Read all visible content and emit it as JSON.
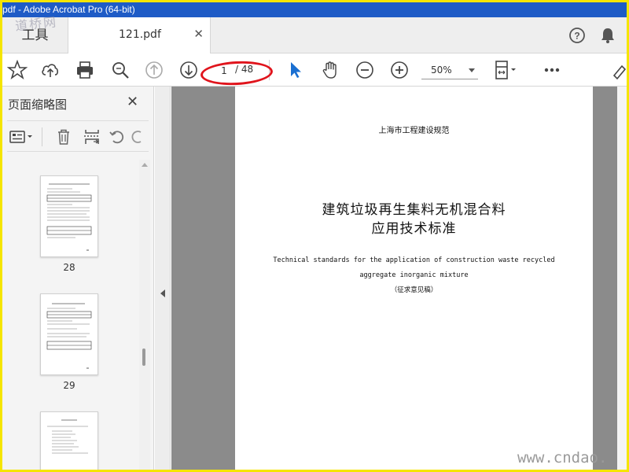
{
  "window": {
    "title": "pdf - Adobe Acrobat Pro (64-bit)"
  },
  "watermarks": {
    "top": "道桥网",
    "bottom": "www.cndao."
  },
  "tabs": {
    "tools_label": "工具",
    "document_label": "121.pdf",
    "close_glyph": "✕"
  },
  "toolbar": {
    "current_page": "1",
    "page_total": "/ 48",
    "zoom": "50%",
    "icons": [
      "star-icon",
      "cloud-upload-icon",
      "print-icon",
      "zoom-search-icon",
      "page-up-icon",
      "page-down-icon",
      "select-arrow-icon",
      "hand-tool-icon",
      "zoom-out-icon",
      "zoom-in-icon",
      "fit-page-icon",
      "more-icon"
    ]
  },
  "left_panel": {
    "title": "页面缩略图",
    "close_glyph": "✕",
    "thumbnails": [
      {
        "label": "28"
      },
      {
        "label": "29"
      },
      {
        "label": ""
      }
    ]
  },
  "document": {
    "header": "上海市工程建设规范",
    "title_line1": "建筑垃圾再生集料无机混合料",
    "title_line2": "应用技术标准",
    "english_line1": "Technical standards for the application of construction waste recycled",
    "english_line2": "aggregate inorganic mixture",
    "draft_note": "（征求意见稿）"
  },
  "colors": {
    "titlebar": "#1e5bc6",
    "annotation": "#e0141c",
    "frame": "#f5e500",
    "accent_blue": "#1a6fd1"
  }
}
